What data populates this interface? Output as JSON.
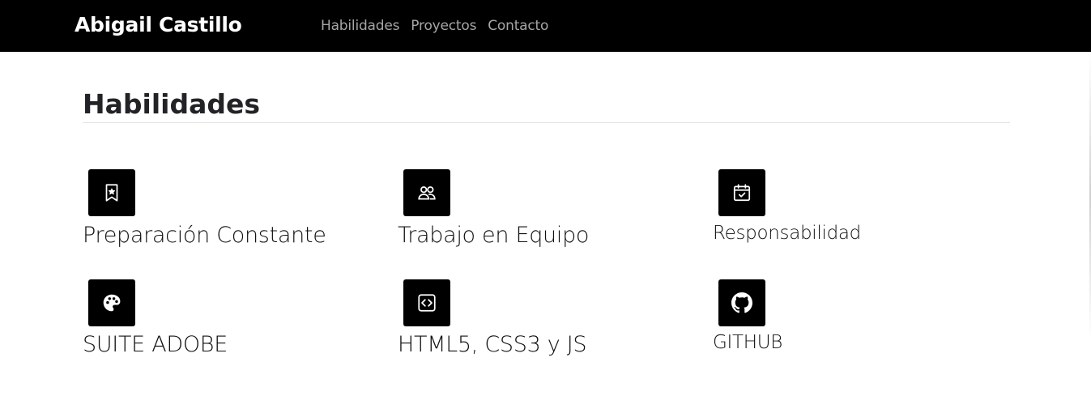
{
  "nav": {
    "brand": "Abigail Castillo",
    "links": [
      "Habilidades",
      "Proyectos",
      "Contacto"
    ]
  },
  "section": {
    "title": "Habilidades"
  },
  "skills": [
    {
      "label": "Preparación Constante",
      "icon": "bookmark-star-icon"
    },
    {
      "label": "Trabajo en Equipo",
      "icon": "people-icon"
    },
    {
      "label": "Responsabilidad",
      "icon": "calendar-check-icon"
    },
    {
      "label": "SUITE ADOBE",
      "icon": "palette-icon"
    },
    {
      "label": "HTML5, CSS3 y JS",
      "icon": "code-square-icon"
    },
    {
      "label": "GITHUB",
      "icon": "github-icon"
    }
  ],
  "colors": {
    "navbar_bg": "#000000",
    "brand_text": "#ffffff",
    "nav_link": "#a6a6a6",
    "icon_bg": "#000000",
    "icon_fg": "#ffffff",
    "title_text": "#222326"
  }
}
